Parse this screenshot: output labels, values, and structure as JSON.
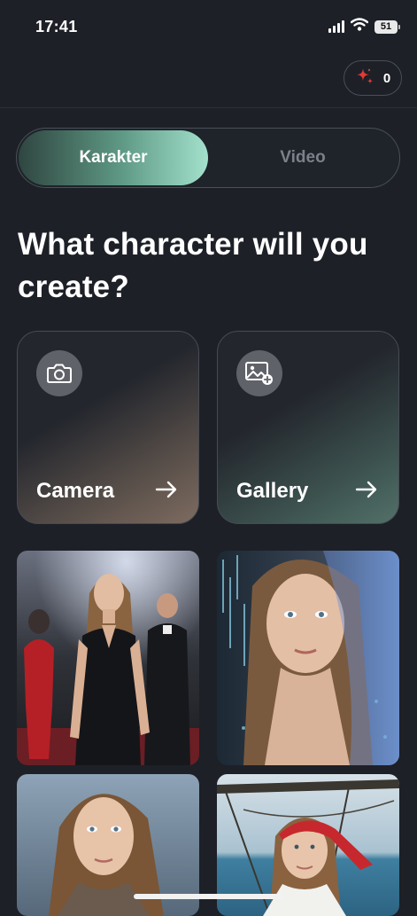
{
  "status_bar": {
    "time": "17:41",
    "battery": "51"
  },
  "header": {
    "credits": "0"
  },
  "mode_toggle": {
    "active": "Karakter",
    "inactive": "Video"
  },
  "headline": "What character will you create?",
  "cards": {
    "camera": {
      "label": "Camera",
      "icon": "camera-icon"
    },
    "gallery": {
      "label": "Gallery",
      "icon": "image-add-icon"
    }
  },
  "colors": {
    "background": "#1d2027",
    "accent": "#a3e1cc",
    "sparkle": "#e53935"
  }
}
